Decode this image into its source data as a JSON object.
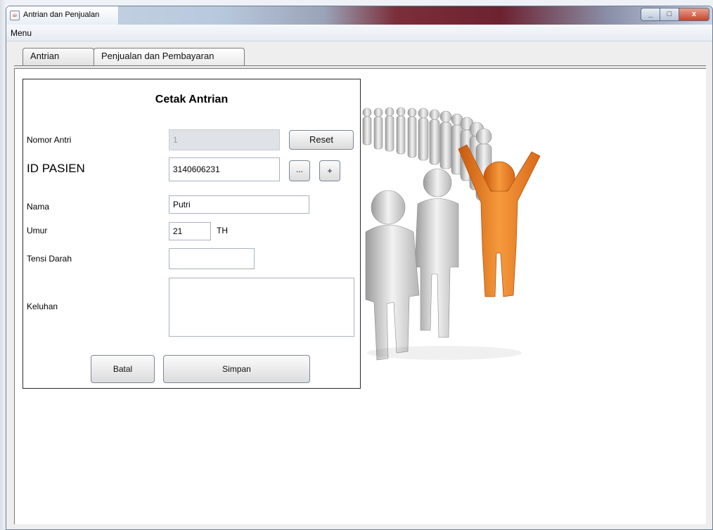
{
  "window": {
    "title": "Antrian dan Penjualan",
    "controls": {
      "minimize": "_",
      "maximize": "□",
      "close": "x"
    }
  },
  "menubar": {
    "menu_label": "Menu"
  },
  "tabs": [
    {
      "label": "Antrian",
      "active": true
    },
    {
      "label": "Penjualan dan Pembayaran",
      "active": false
    }
  ],
  "form": {
    "title": "Cetak Antrian",
    "nomor_antri": {
      "label": "Nomor Antri",
      "value": "1"
    },
    "reset_label": "Reset",
    "id_pasien": {
      "label": "ID PASIEN",
      "value": "3140606231"
    },
    "browse_label": "...",
    "add_label": "+",
    "nama": {
      "label": "Nama",
      "value": "Putri"
    },
    "umur": {
      "label": "Umur",
      "value": "21",
      "unit": "TH"
    },
    "tensi": {
      "label": "Tensi Darah",
      "value": ""
    },
    "keluhan": {
      "label": "Keluhan",
      "value": ""
    },
    "batal_label": "Batal",
    "simpan_label": "Simpan"
  },
  "colors": {
    "accent_figure": "#e87722",
    "figures": "#c9c9c9"
  },
  "icons": {
    "app": "java-cup-icon",
    "illustration": "queue-people-illustration"
  }
}
